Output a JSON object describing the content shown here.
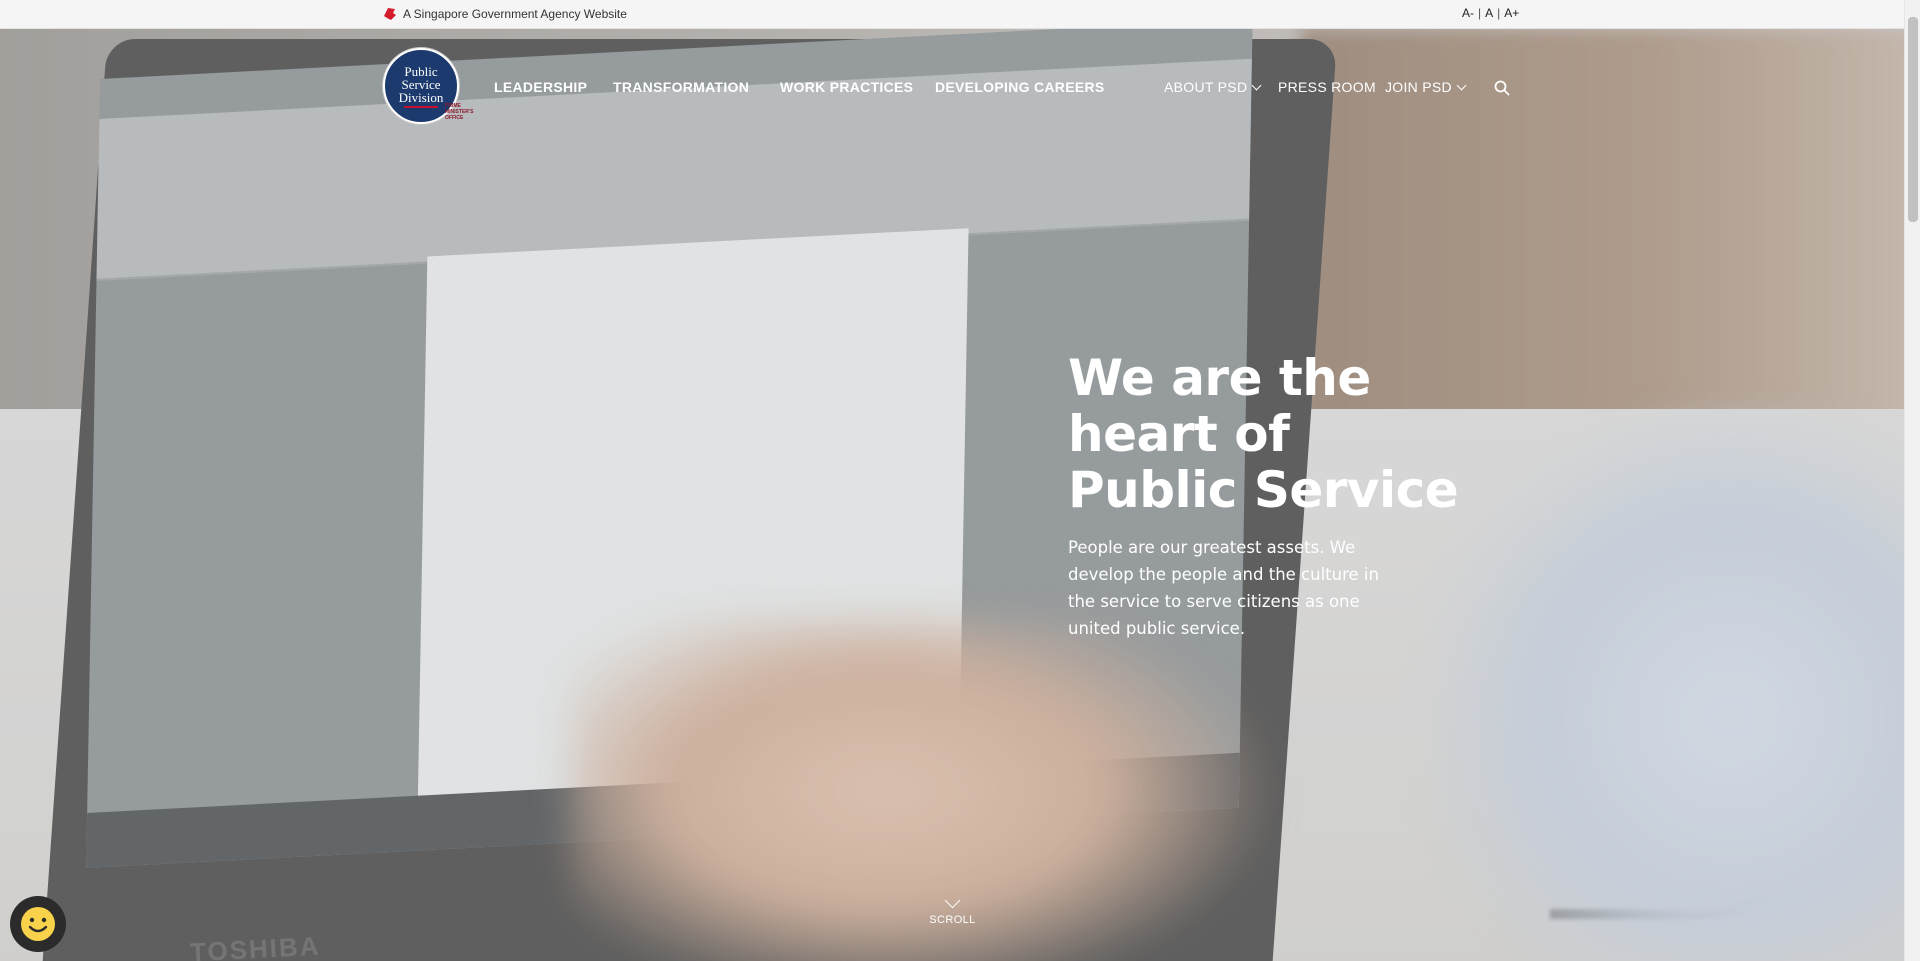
{
  "masthead": {
    "gov_text": "A Singapore Government Agency Website",
    "font_sizes": [
      "A-",
      "A",
      "A+"
    ],
    "separator": "|"
  },
  "logo": {
    "line1": "Public",
    "line2": "Service",
    "line3": "Division",
    "sub_line1": "PRIME",
    "sub_line2": "MINISTER'S",
    "sub_line3": "OFFICE"
  },
  "nav": {
    "items": [
      {
        "label": "LEADERSHIP"
      },
      {
        "label": "TRANSFORMATION"
      },
      {
        "label": "WORK PRACTICES"
      },
      {
        "label": "DEVELOPING CAREERS"
      }
    ],
    "right_items": [
      {
        "label": "ABOUT PSD",
        "has_dropdown": true
      },
      {
        "label": "PRESS ROOM",
        "has_dropdown": false
      },
      {
        "label": "JOIN PSD",
        "has_dropdown": true
      }
    ],
    "search_icon": "search-icon"
  },
  "hero": {
    "headline_lines": [
      "We are the",
      "heart of",
      "Public Service"
    ],
    "subtext": "People are our greatest assets. We develop the people and the culture in the service to serve citizens as one united public service.",
    "scroll_label": "SCROLL"
  },
  "background": {
    "laptop_brand": "TOSHIBA"
  },
  "colors": {
    "logo_blue": "#1c3a6d",
    "accent_red": "#c8102e",
    "nav_text": "#ffffff"
  }
}
